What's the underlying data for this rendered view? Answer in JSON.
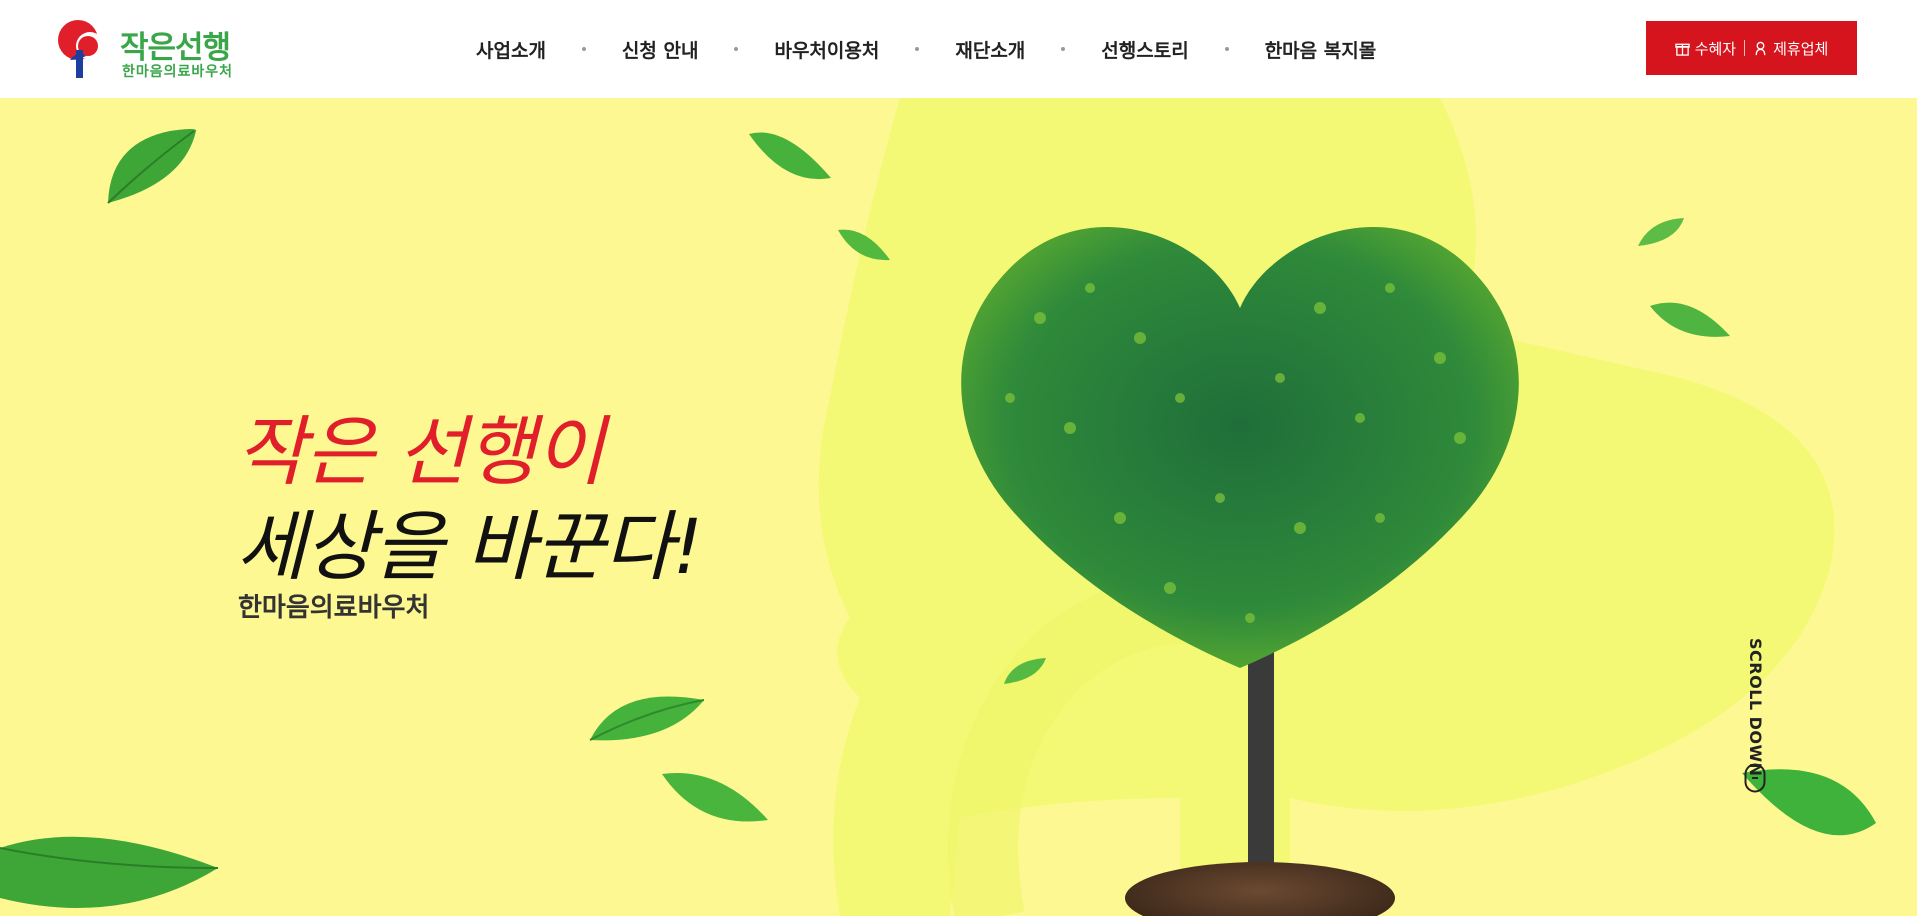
{
  "header": {
    "logo": {
      "title": "작은선행",
      "subtitle": "한마음의료바우처"
    },
    "nav": [
      {
        "label": "사업소개"
      },
      {
        "label": "신청 안내"
      },
      {
        "label": "바우처이용처"
      },
      {
        "label": "재단소개"
      },
      {
        "label": "선행스토리"
      },
      {
        "label": "한마음 복지몰"
      }
    ],
    "cta": {
      "recipient_label": "수혜자",
      "partner_label": "제휴업체",
      "recipient_icon": "gift-icon",
      "partner_icon": "partner-icon"
    }
  },
  "hero": {
    "headline_line1": "작은 선행이",
    "headline_line2": "세상을 바꾼다!",
    "subhead": "한마음의료바우처",
    "scroll_label": "SCROLL DOWN",
    "scroll_icon": "mouse-icon",
    "image": "heart-shaped-tree"
  },
  "colors": {
    "brand_green": "#3aa64a",
    "brand_red": "#d6141d",
    "hero_background": "#fdf892",
    "headline_red": "#e01f2a"
  }
}
